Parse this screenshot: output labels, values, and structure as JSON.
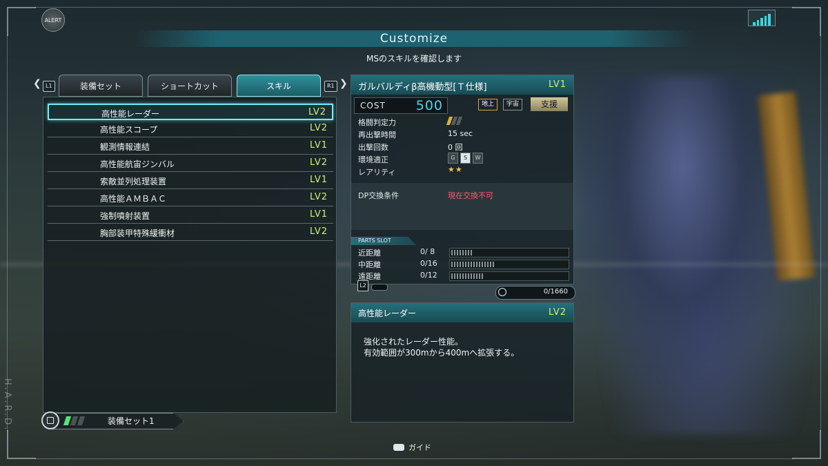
{
  "alert_label": "ALERT",
  "title": "Customize",
  "subtitle": "MSのスキルを確認します",
  "nav": {
    "left_bumper": "L1",
    "right_bumper": "R1",
    "tabs": [
      {
        "label": "装備セット"
      },
      {
        "label": "ショートカット"
      },
      {
        "label": "スキル"
      }
    ]
  },
  "skills": [
    {
      "name": "高性能レーダー",
      "level": "LV2"
    },
    {
      "name": "高性能スコープ",
      "level": "LV2"
    },
    {
      "name": "観測情報連結",
      "level": "LV1"
    },
    {
      "name": "高性能航宙ジンバル",
      "level": "LV2"
    },
    {
      "name": "索敵並列処理装置",
      "level": "LV1"
    },
    {
      "name": "高性能ＡＭＢＡＣ",
      "level": "LV2"
    },
    {
      "name": "強制噴射装置",
      "level": "LV1"
    },
    {
      "name": "胸部装甲特殊緩衝材",
      "level": "LV2"
    }
  ],
  "loadout": {
    "label": "装備セット1",
    "active_pips": 1,
    "total_pips": 3
  },
  "ms": {
    "name": "ガルバルディβ高機動型[Ｔ仕様]",
    "level": "LV1",
    "cost_label": "COST",
    "cost": "500",
    "env_tags": [
      "地上",
      "宇宙"
    ],
    "role": "支援",
    "stats": {
      "melee_label": "格闘判定力",
      "melee_gauge": {
        "filled": 1,
        "total": 3
      },
      "respawn_label": "再出撃時間",
      "respawn_value": "15 sec",
      "sorties_label": "出撃回数",
      "sorties_value": "0 回",
      "env_label": "環境適正",
      "env_icons": [
        "G",
        "S",
        "W"
      ],
      "rarity_label": "レアリティ",
      "rarity_value": "★★"
    },
    "dp_label": "DP交換条件",
    "dp_value": "現在交換不可"
  },
  "parts_slot": {
    "title": "PARTS SLOT",
    "rows": [
      {
        "label": "近距離",
        "value": "0/ 8",
        "capacity": 8
      },
      {
        "label": "中距離",
        "value": "0/16",
        "capacity": 16
      },
      {
        "label": "遠距離",
        "value": "0/12",
        "capacity": 12
      }
    ],
    "l2_label": "L2",
    "weight_value": "0/1660"
  },
  "description": {
    "title": "高性能レーダー",
    "level": "LV2",
    "lines": [
      "強化されたレーダー性能。",
      "有効範囲が300mから400mへ拡張する。"
    ]
  },
  "guide_label": "ガイド",
  "side_text": "H.A.R.D.",
  "colors": {
    "accent": "#6ff0f5",
    "level": "#c9f27a",
    "cost": "#48d9f0",
    "warning": "#ff5a6c"
  }
}
